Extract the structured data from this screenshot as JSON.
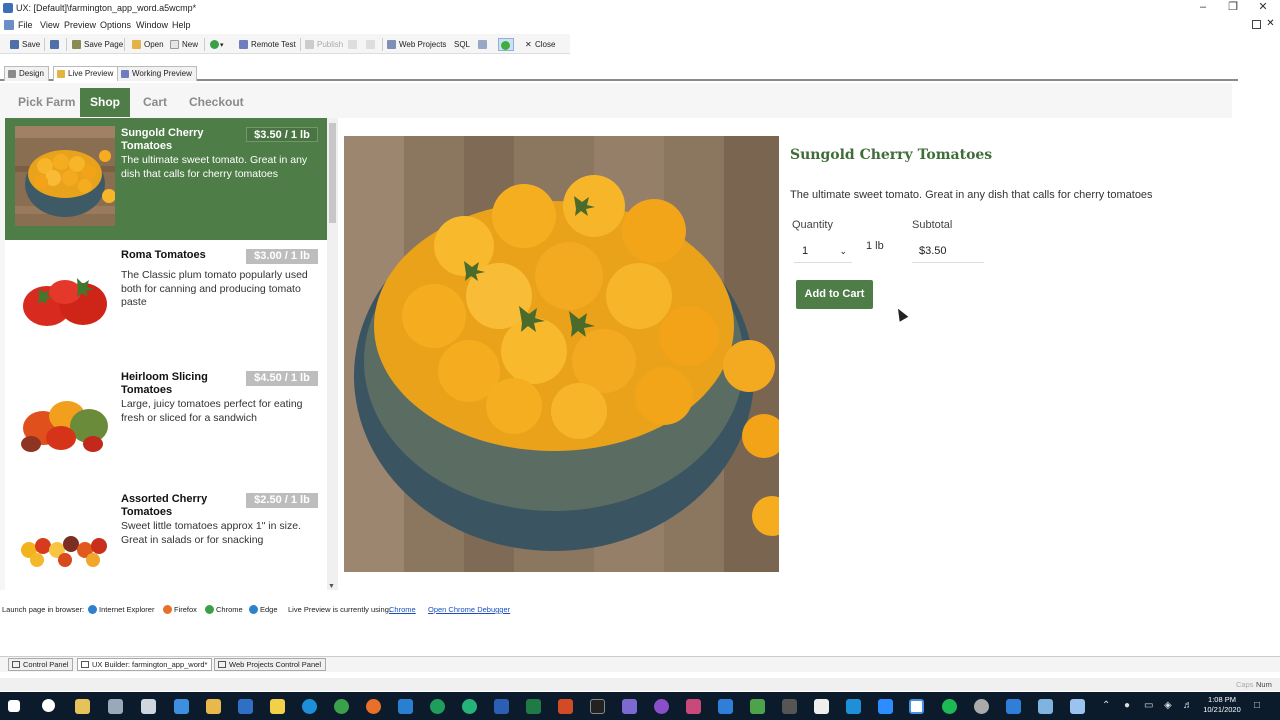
{
  "window": {
    "title": "UX: [Default]\\farmington_app_word.a5wcmp*"
  },
  "menu": [
    "File",
    "View",
    "Preview",
    "Options",
    "Window",
    "Help"
  ],
  "toolbar": {
    "save": "Save",
    "save_page": "Save Page",
    "open": "Open",
    "new": "New",
    "remote_test": "Remote Test",
    "publish": "Publish",
    "web_projects": "Web Projects",
    "sql": "SQL",
    "close": "Close"
  },
  "mode_tabs": [
    "Design",
    "Live Preview",
    "Working Preview"
  ],
  "app": {
    "nav": [
      "Pick Farm",
      "Shop",
      "Cart",
      "Checkout"
    ],
    "active_nav": "Shop",
    "products": [
      {
        "name": "Sungold Cherry Tomatoes",
        "price": "$3.50  / 1 lb",
        "desc": "The ultimate sweet tomato. Great in any dish that calls for cherry tomatoes",
        "selected": true
      },
      {
        "name": "Roma Tomatoes",
        "price": "$3.00  / 1 lb",
        "desc": "The Classic plum tomato popularly used both for canning and producing tomato paste",
        "selected": false
      },
      {
        "name": "Heirloom Slicing Tomatoes",
        "price": "$4.50  / 1 lb",
        "desc": "Large, juicy tomatoes perfect for eating fresh or sliced for a sandwich",
        "selected": false
      },
      {
        "name": "Assorted Cherry Tomatoes",
        "price": "$2.50  / 1 lb",
        "desc": "Sweet little tomatoes approx 1\" in size. Great in salads or for snacking",
        "selected": false
      }
    ],
    "detail": {
      "title": "Sungold Cherry Tomatoes",
      "desc": "The ultimate sweet tomato. Great in any dish that calls for cherry tomatoes",
      "quantity_label": "Quantity",
      "quantity_value": "1",
      "unit": "1 lb",
      "subtotal_label": "Subtotal",
      "subtotal_value": "$3.50",
      "add_button": "Add to Cart"
    }
  },
  "launch": {
    "label": "Launch page in browser:",
    "browsers": [
      "Internet Explorer",
      "Firefox",
      "Chrome",
      "Edge"
    ],
    "using_label": "Live Preview is currently using:",
    "using_value": "Chrome",
    "debugger": "Open Chrome Debugger"
  },
  "bottom_tabs": [
    "Control Panel",
    "UX Builder: farmington_app_word*",
    "Web Projects Control Panel"
  ],
  "status": {
    "caps": "Caps",
    "num": "Num"
  },
  "clock": {
    "time": "1:08 PM",
    "date": "10/21/2020"
  },
  "colors": {
    "brand_green": "#4e7d48",
    "price_badge": "#bdbdbd",
    "taskbar": "#0c1b2c"
  }
}
